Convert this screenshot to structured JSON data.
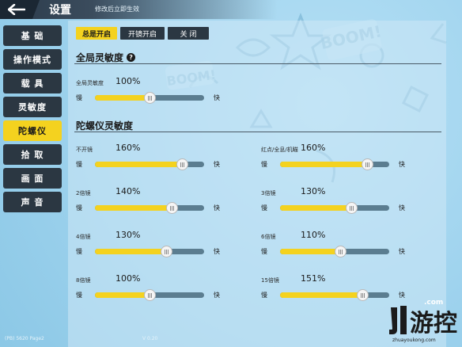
{
  "header": {
    "title": "设置",
    "hint": "修改后立即生效"
  },
  "sidebar": {
    "items": [
      {
        "label": "基 础",
        "active": false
      },
      {
        "label": "操作模式",
        "active": false
      },
      {
        "label": "载 具",
        "active": false
      },
      {
        "label": "灵敏度",
        "active": false
      },
      {
        "label": "陀螺仪",
        "active": true
      },
      {
        "label": "拾 取",
        "active": false
      },
      {
        "label": "画 面",
        "active": false
      },
      {
        "label": "声 音",
        "active": false
      }
    ]
  },
  "mode_tabs": [
    {
      "label": "总是开启",
      "active": true
    },
    {
      "label": "开镜开启",
      "active": false
    },
    {
      "label": "关 闭",
      "active": false
    }
  ],
  "global": {
    "title": "全局灵敏度",
    "help": "?",
    "slider": {
      "label": "全局灵敏度",
      "value_text": "100%",
      "value": 100
    }
  },
  "gyro": {
    "title": "陀螺仪灵敏度",
    "sliders": [
      {
        "label": "不开镜",
        "value_text": "160%",
        "value": 160
      },
      {
        "label": "红点/全息/机瞄",
        "value_text": "160%",
        "value": 160
      },
      {
        "label": "2倍镜",
        "value_text": "140%",
        "value": 140
      },
      {
        "label": "3倍镜",
        "value_text": "130%",
        "value": 130
      },
      {
        "label": "4倍镜",
        "value_text": "130%",
        "value": 130
      },
      {
        "label": "6倍镜",
        "value_text": "110%",
        "value": 110
      },
      {
        "label": "8倍镜",
        "value_text": "100%",
        "value": 100
      },
      {
        "label": "15倍镜",
        "value_text": "151%",
        "value": 151
      }
    ]
  },
  "slider_common": {
    "slow": "慢",
    "fast": "快",
    "min": 0,
    "max": 200
  },
  "footer": {
    "left": "(PB) 5620 Page2",
    "mid": "V 0.20"
  },
  "watermark": {
    "com": ".com",
    "brand": "爪游控",
    "url": "zhuayoukong.com"
  },
  "colors": {
    "accent": "#f4d21f",
    "dark": "#2b3742",
    "track": "#5b7d90",
    "background": "#9fd3ee"
  }
}
